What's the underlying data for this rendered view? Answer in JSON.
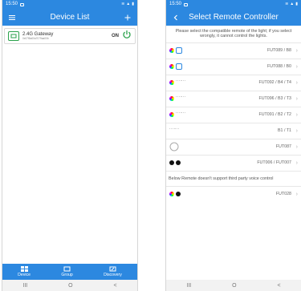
{
  "left": {
    "status_time": "15:50",
    "title": "Device List",
    "gateway": {
      "name": "2.4G Gateway",
      "id": "0x07f8a00a7079aa00b",
      "state": "ON"
    },
    "tabs": [
      {
        "label": "Device"
      },
      {
        "label": "Group"
      },
      {
        "label": "Discovery"
      }
    ],
    "sysnav": [
      "III",
      "O",
      "<"
    ]
  },
  "right": {
    "status_time": "15:50",
    "title": "Select Remote Controller",
    "notice": "Please select the compatible remote of the light; if you select wrongly, it cannot control the lights.",
    "items": [
      "FUT089 / B8",
      "FUT088 / B0",
      "FUT092 / B4 / T4",
      "FUT096 / B3 / T3",
      "FUT091 / B2 / T2",
      "B1 / T1",
      "FUT087",
      "FUT006 / FUT007"
    ],
    "note2": "Below Remote doesn't support third party voice control",
    "item_last": "FUT028",
    "sysnav": [
      "III",
      "O",
      "<"
    ]
  },
  "colors": {
    "brand": "#2c88e0",
    "power": "#2aa24b"
  }
}
